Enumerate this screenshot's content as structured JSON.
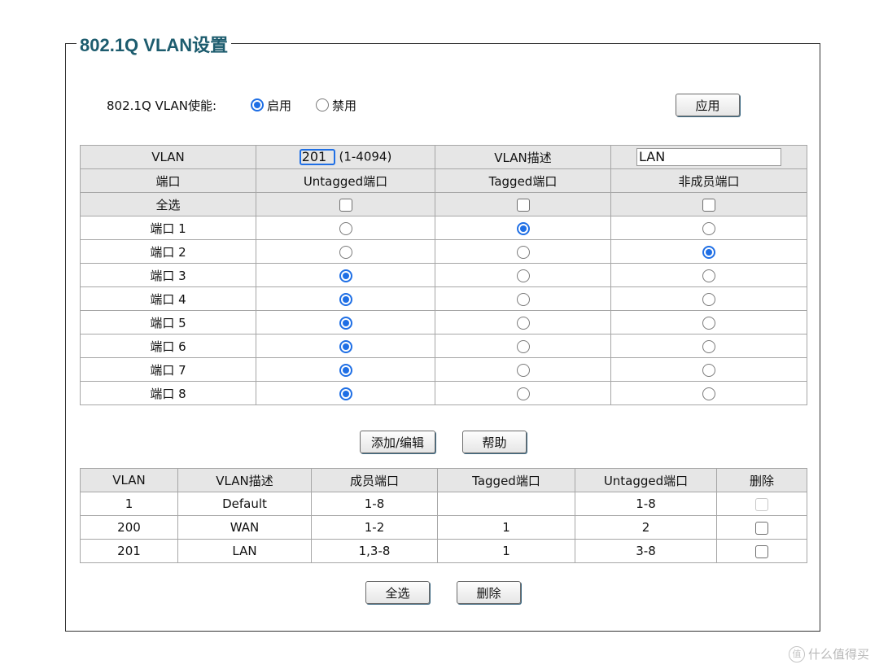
{
  "section_title": "802.1Q VLAN设置",
  "enable": {
    "label": "802.1Q VLAN使能:",
    "options": [
      {
        "label": "启用",
        "checked": true
      },
      {
        "label": "禁用",
        "checked": false
      }
    ],
    "apply_button": "应用"
  },
  "config": {
    "vlan_label": "VLAN",
    "vlan_id_value": "201",
    "vlan_range": "(1-4094)",
    "desc_label": "VLAN描述",
    "desc_value": "LAN",
    "col_port": "端口",
    "col_untagged": "Untagged端口",
    "col_tagged": "Tagged端口",
    "col_nonmember": "非成员端口",
    "select_all_label": "全选",
    "ports": [
      {
        "label": "端口 1",
        "mode": "tagged"
      },
      {
        "label": "端口 2",
        "mode": "nonmember"
      },
      {
        "label": "端口 3",
        "mode": "untagged"
      },
      {
        "label": "端口 4",
        "mode": "untagged"
      },
      {
        "label": "端口 5",
        "mode": "untagged"
      },
      {
        "label": "端口 6",
        "mode": "untagged"
      },
      {
        "label": "端口 7",
        "mode": "untagged"
      },
      {
        "label": "端口 8",
        "mode": "untagged"
      }
    ],
    "add_edit_button": "添加/编辑",
    "help_button": "帮助"
  },
  "list": {
    "headers": [
      "VLAN",
      "VLAN描述",
      "成员端口",
      "Tagged端口",
      "Untagged端口",
      "删除"
    ],
    "rows": [
      {
        "vlan": "1",
        "desc": "Default",
        "members": "1-8",
        "tagged": "",
        "untagged": "1-8",
        "delete_disabled": true
      },
      {
        "vlan": "200",
        "desc": "WAN",
        "members": "1-2",
        "tagged": "1",
        "untagged": "2",
        "delete_disabled": false
      },
      {
        "vlan": "201",
        "desc": "LAN",
        "members": "1,3-8",
        "tagged": "1",
        "untagged": "3-8",
        "delete_disabled": false
      }
    ],
    "select_all_button": "全选",
    "delete_button": "删除"
  },
  "watermark": "什么值得买",
  "watermark_logo": "值",
  "colors": {
    "accent": "#1f6fe5",
    "title": "#1d5c6e",
    "header_bg": "#e6e6e6"
  }
}
